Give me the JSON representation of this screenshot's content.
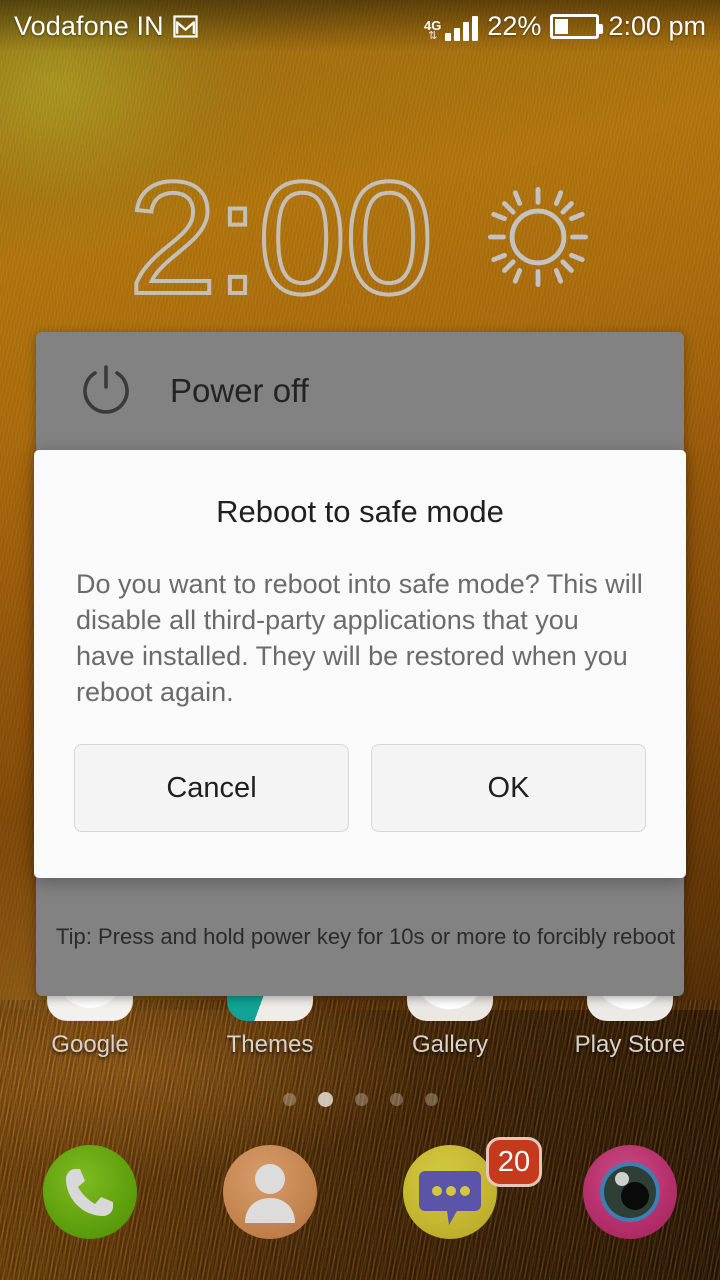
{
  "statusbar": {
    "carrier": "Vodafone IN",
    "mail_icon": "gmail-envelope-icon",
    "network_type": "4G",
    "data_arrows": "⇅",
    "battery_percent": "22%",
    "battery_level": 22,
    "clock": "2:00 pm"
  },
  "clock_widget": {
    "time": "2:00",
    "weather_icon": "sun-icon"
  },
  "power_menu": {
    "power_off_label": "Power off",
    "power_icon": "power-icon",
    "tip": "Tip: Press and hold power key for 10s or more to forcibly reboot"
  },
  "dialog": {
    "title": "Reboot to safe mode",
    "message": "Do you want to reboot into safe mode? This will disable all third-party applications that you have installed. They will be restored when you reboot again.",
    "cancel_label": "Cancel",
    "ok_label": "OK"
  },
  "home": {
    "apps": [
      {
        "label": "Google",
        "icon": "google-icon"
      },
      {
        "label": "Themes",
        "icon": "themes-icon"
      },
      {
        "label": "Gallery",
        "icon": "gallery-icon"
      },
      {
        "label": "Play Store",
        "icon": "play-store-icon"
      }
    ],
    "page_dots": {
      "count": 5,
      "active_index": 1
    },
    "dock": [
      {
        "name": "phone",
        "icon": "phone-icon",
        "badge": ""
      },
      {
        "name": "contacts",
        "icon": "contacts-icon",
        "badge": ""
      },
      {
        "name": "messaging",
        "icon": "message-icon",
        "badge": "20"
      },
      {
        "name": "camera",
        "icon": "camera-icon",
        "badge": ""
      }
    ]
  },
  "colors": {
    "panel_gray": "#828282",
    "dialog_bg": "#fafafa",
    "badge_red": "#c5391c",
    "wallpaper_amber": "#b4770d",
    "wallpaper_brown": "#3a1f04"
  }
}
